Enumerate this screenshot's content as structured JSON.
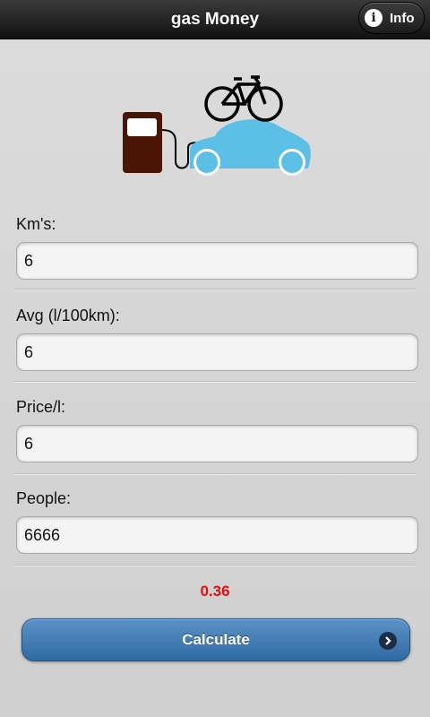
{
  "header": {
    "title": "gas Money",
    "info_label": "Info"
  },
  "fields": [
    {
      "label": "Km's:",
      "value": "6"
    },
    {
      "label": "Avg (l/100km):",
      "value": "6"
    },
    {
      "label": "Price/l:",
      "value": "6"
    },
    {
      "label": "People:",
      "value": "6666"
    }
  ],
  "result": "0.36",
  "calculate_label": "Calculate",
  "colors": {
    "result": "#e01010",
    "button": "#3f7bb5",
    "car": "#5bbfe6",
    "pump": "#4a1505"
  }
}
